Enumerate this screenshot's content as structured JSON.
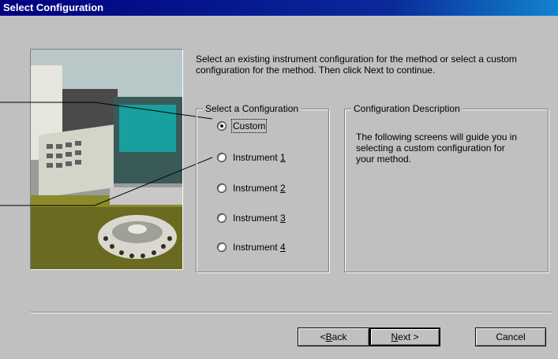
{
  "window": {
    "title": "Select Configuration"
  },
  "intro": "Select an existing instrument configuration for the method or select a custom configuration for the method. Then click Next to continue.",
  "config_group": {
    "label": "Select a Configuration",
    "options": [
      {
        "label": "Custom",
        "checked": true
      },
      {
        "label_prefix": "Instrument ",
        "accel": "1",
        "checked": false
      },
      {
        "label_prefix": "Instrument ",
        "accel": "2",
        "checked": false
      },
      {
        "label_prefix": "Instrument ",
        "accel": "3",
        "checked": false
      },
      {
        "label_prefix": "Instrument ",
        "accel": "4",
        "checked": false
      }
    ]
  },
  "description_group": {
    "label": "Configuration Description",
    "text": "The following screens will guide you in selecting a custom configuration for your method."
  },
  "buttons": {
    "back": {
      "prefix": "< ",
      "accel": "B",
      "rest": "ack"
    },
    "next": {
      "accel": "N",
      "rest": "ext >"
    },
    "cancel": {
      "label": "Cancel"
    }
  },
  "colors": {
    "titlebar": "#000080",
    "dialog": "#c0c0c0"
  }
}
